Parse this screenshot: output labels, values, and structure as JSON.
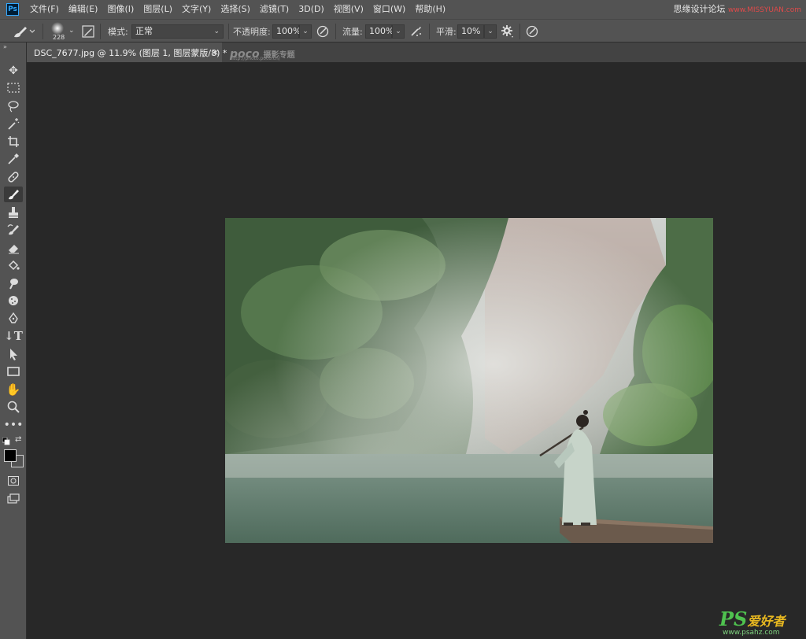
{
  "app": {
    "logo": "Ps"
  },
  "menubar": {
    "items": [
      "文件(F)",
      "编辑(E)",
      "图像(I)",
      "图层(L)",
      "文字(Y)",
      "选择(S)",
      "滤镜(T)",
      "3D(D)",
      "视图(V)",
      "窗口(W)",
      "帮助(H)"
    ],
    "watermark": "思缘设计论坛",
    "watermark_url": "www.MISSYUAN.com"
  },
  "options": {
    "brush_size": "228",
    "mode_label": "模式:",
    "mode_value": "正常",
    "opacity_label": "不透明度:",
    "opacity_value": "100%",
    "flow_label": "流量:",
    "flow_value": "100%",
    "smoothing_label": "平滑:",
    "smoothing_value": "10%"
  },
  "document": {
    "tab_title": "DSC_7677.jpg @ 11.9% (图层 1, 图层蒙版/8) *",
    "close": "×"
  },
  "poco": {
    "brand": "poco",
    "subtitle": "摄影专题",
    "url": "http://photo.poco.cn/"
  },
  "corner_watermark": {
    "ps": "PS",
    "zh": "爱好者",
    "url": "www.psahz.com"
  },
  "colors": {
    "foreground": "#000000",
    "background": "#ffffff"
  },
  "tools": [
    "move-icon",
    "marquee-icon",
    "lasso-icon",
    "magic-wand-icon",
    "crop-icon",
    "eyedropper-icon",
    "healing-icon",
    "brush-icon",
    "stamp-icon",
    "history-brush-icon",
    "eraser-icon",
    "paint-bucket-icon",
    "smudge-icon",
    "sponge-icon",
    "pen-icon",
    "type-icon",
    "path-select-icon",
    "rectangle-icon",
    "hand-icon",
    "zoom-icon",
    "more-icon"
  ]
}
